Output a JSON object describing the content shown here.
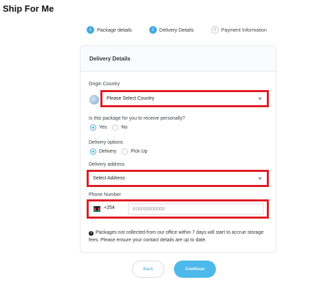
{
  "page": {
    "title": "Ship For Me"
  },
  "stepper": {
    "steps": [
      {
        "number": "1",
        "label": "Package details",
        "state": "active"
      },
      {
        "number": "2",
        "label": "Delivery Details",
        "state": "active"
      },
      {
        "number": "3",
        "label": "Payment Information",
        "state": "inactive"
      }
    ]
  },
  "card": {
    "title": "Delivery Details"
  },
  "origin": {
    "label": "Origin Country",
    "value": "Please Select Country",
    "icon": "globe-icon"
  },
  "personal": {
    "question": "Is this package for you to receive personally?",
    "options": [
      {
        "label": "Yes",
        "checked": true
      },
      {
        "label": "No",
        "checked": false
      }
    ]
  },
  "delivery_options": {
    "label": "Delivery options",
    "options": [
      {
        "label": "Delivery",
        "checked": true
      },
      {
        "label": "Pick Up",
        "checked": false
      }
    ]
  },
  "address": {
    "label": "Delivery address",
    "value": "Select Address"
  },
  "phone": {
    "label": "Phone Number",
    "dial_code": "+254",
    "placeholder": "816000000000",
    "flag": "kenya-flag-icon"
  },
  "notice": {
    "text": "Packages not collected from our office within 7 days will start to accrue storage fees. Please ensure your contact details are up to date."
  },
  "buttons": {
    "back": "Back",
    "continue": "Continue"
  },
  "colors": {
    "accent": "#3fa9e0",
    "highlight_border": "#e01b22"
  }
}
